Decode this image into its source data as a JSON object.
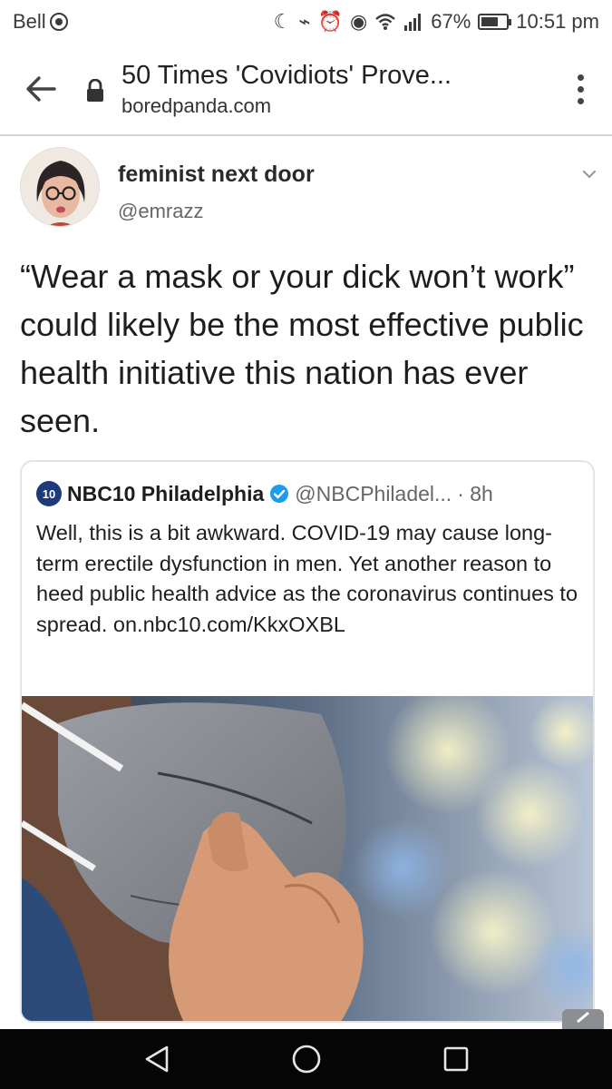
{
  "status_bar": {
    "carrier": "Bell",
    "battery": "67%",
    "time": "10:51 pm",
    "icons": [
      "moon-icon",
      "vibrate-off-icon",
      "alarm-icon",
      "eye-comfort-icon",
      "wifi-icon",
      "signal-icon",
      "battery-icon"
    ]
  },
  "toolbar": {
    "page_title": "50 Times 'Covidiots' Prove...",
    "domain": "boredpanda.com"
  },
  "tweet": {
    "author_name": "feminist next door",
    "author_handle": "@emrazz",
    "text": "“Wear a mask or your dick won’t work” could likely be the most effective public health initiative this nation has ever seen."
  },
  "quoted_tweet": {
    "logo_text": "10",
    "author_name": "NBC10 Philadelphia",
    "author_handle": "@NBCPhiladel...",
    "time": "· 8h",
    "text": "Well, this is a bit awkward. COVID-19 may cause long-term erectile dysfunction in men. Yet another reason to heed public health advice as the coronavirus continues to spread. on.nbc10.com/KkxOXBL"
  },
  "colors": {
    "nbc_blue": "#1e3a7a",
    "verified_blue": "#1d9bf0",
    "nav_bar": "#050505"
  }
}
